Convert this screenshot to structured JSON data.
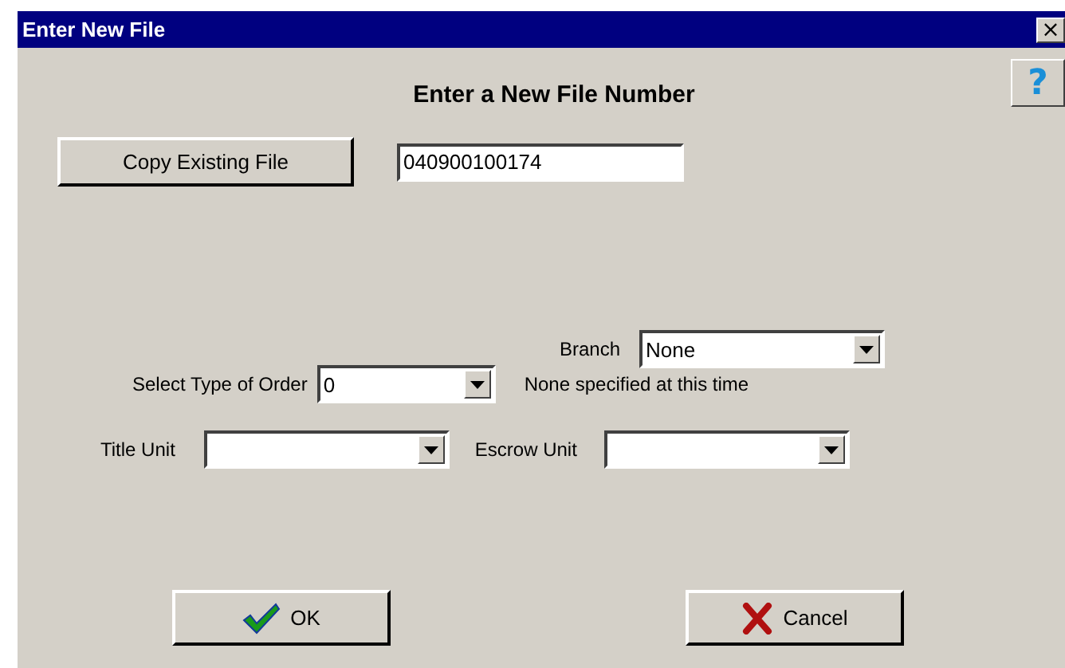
{
  "window": {
    "title": "Enter New File",
    "close": "×",
    "help": "?"
  },
  "heading": "Enter a New File Number",
  "copy_button": "Copy Existing File",
  "file_number": {
    "value": "040900100174"
  },
  "order_type": {
    "label": "Select Type of Order",
    "value": "0",
    "description": "None specified at this time"
  },
  "branch": {
    "label": "Branch",
    "value": "None"
  },
  "title_unit": {
    "label": "Title Unit"
  },
  "escrow_unit": {
    "label": "Escrow Unit"
  },
  "buttons": [
    {
      "kind": "ok",
      "label": "OK"
    },
    {
      "kind": "cancel",
      "label": "Cancel"
    }
  ]
}
